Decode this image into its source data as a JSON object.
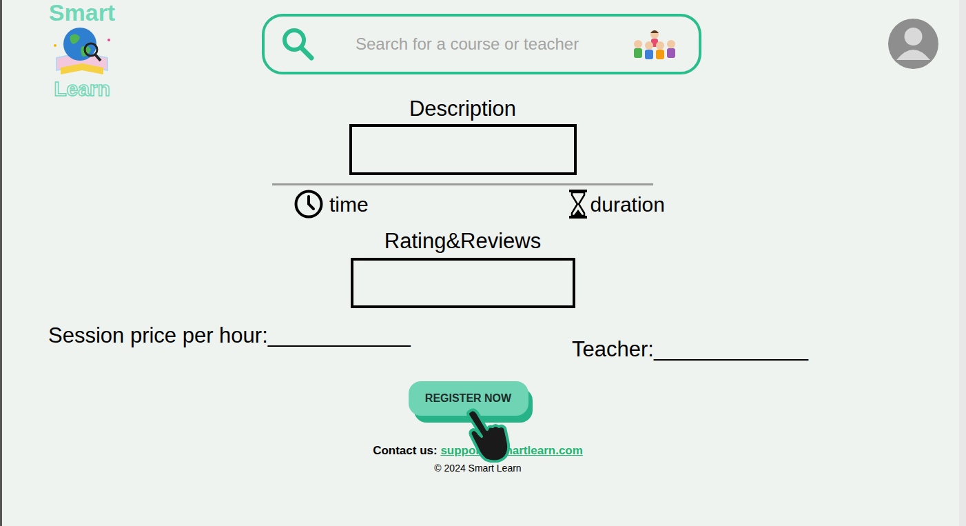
{
  "logo": {
    "top": "Smart",
    "bottom": "Learn"
  },
  "search": {
    "placeholder": "Search for a course or teacher"
  },
  "course": {
    "description_label": "Description",
    "time_label": "time",
    "duration_label": "duration",
    "reviews_label": "Rating&Reviews",
    "price_label": "Session price per hour:",
    "price_value": "____________",
    "teacher_label": "Teacher:",
    "teacher_value": "_____________"
  },
  "register_button": "REGISTER NOW",
  "footer": {
    "contact_label": "Contact us:",
    "email": "support@smartlearn.com",
    "copyright": "© 2024 Smart Learn"
  }
}
